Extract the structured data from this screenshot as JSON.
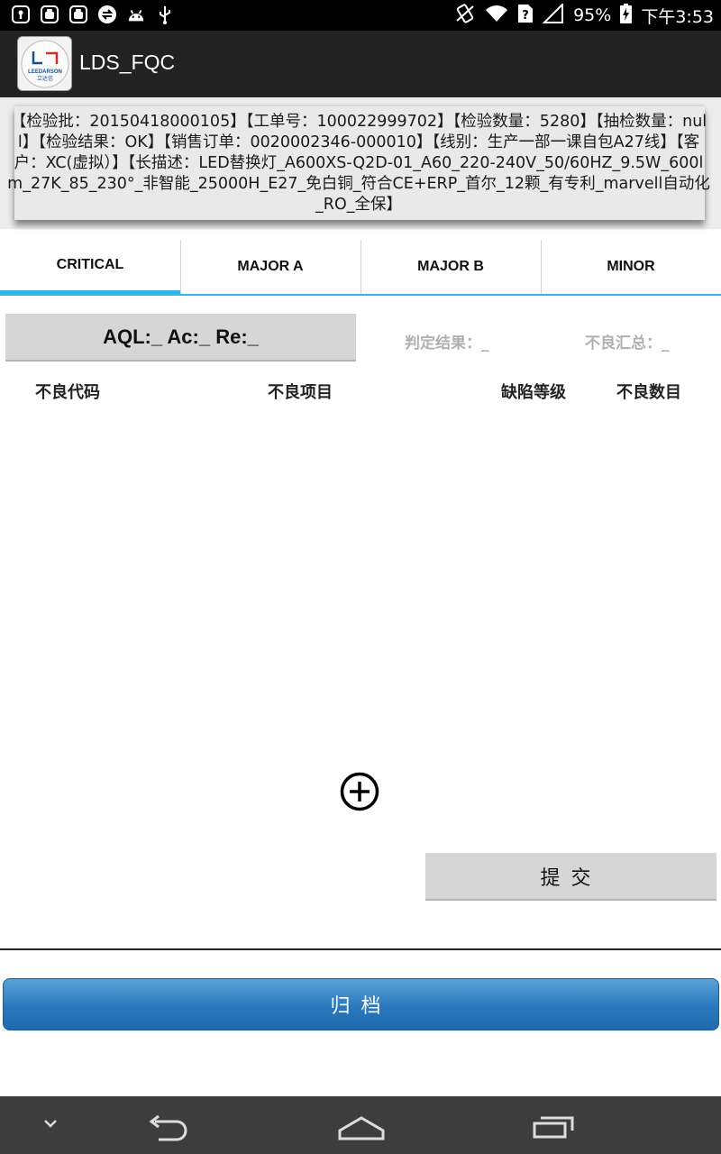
{
  "status_bar": {
    "battery": "95%",
    "time": "下午3:53",
    "icons": [
      "lock-icon",
      "android-icon",
      "android-icon",
      "sync-icon",
      "android-icon",
      "usb-icon",
      "vibrate-icon",
      "wifi-icon",
      "sim-missing-icon",
      "signal-icon",
      "battery-charging-icon"
    ]
  },
  "app_bar": {
    "title": "LDS_FQC",
    "logo_text": "LEEDARSON",
    "logo_sub": "立达信"
  },
  "info": {
    "text": "【检验批：20150418000105】【工单号：100022999702】【检验数量：5280】【抽检数量：null】【检验结果：OK】【销售订单：0020002346-000010】【线别：生产一部一课自包A27线】【客户：XC(虚拟）】【长描述：LED替换灯_A600XS-Q2D-01_A60_220-240V_50/60HZ_9.5W_600lm_27K_85_230°_非智能_25000H_E27_免白铜_符合CE+ERP_首尔_12颗_有专利_marvell自动化_RO_全保】"
  },
  "tabs": [
    {
      "label": "CRITICAL",
      "active": true
    },
    {
      "label": "MAJOR A",
      "active": false
    },
    {
      "label": "MAJOR B",
      "active": false
    },
    {
      "label": "MINOR",
      "active": false
    }
  ],
  "aql": {
    "button_label": "AQL:_ Ac:_ Re:_",
    "judge_label": "判定结果：_",
    "defect_sum_label": "不良汇总：_"
  },
  "columns": [
    "不良代码",
    "不良项目",
    "缺陷等级",
    "不良数目"
  ],
  "actions": {
    "add_icon": "add-circle-icon",
    "submit_label": "提交",
    "archive_label": "归档"
  },
  "nav": {
    "icons": [
      "chevron-down-icon",
      "back-icon",
      "home-icon",
      "recents-icon"
    ]
  },
  "colors": {
    "accent": "#33b5e5",
    "archive_button": "#2a78bd",
    "action_bar": "#222222"
  }
}
